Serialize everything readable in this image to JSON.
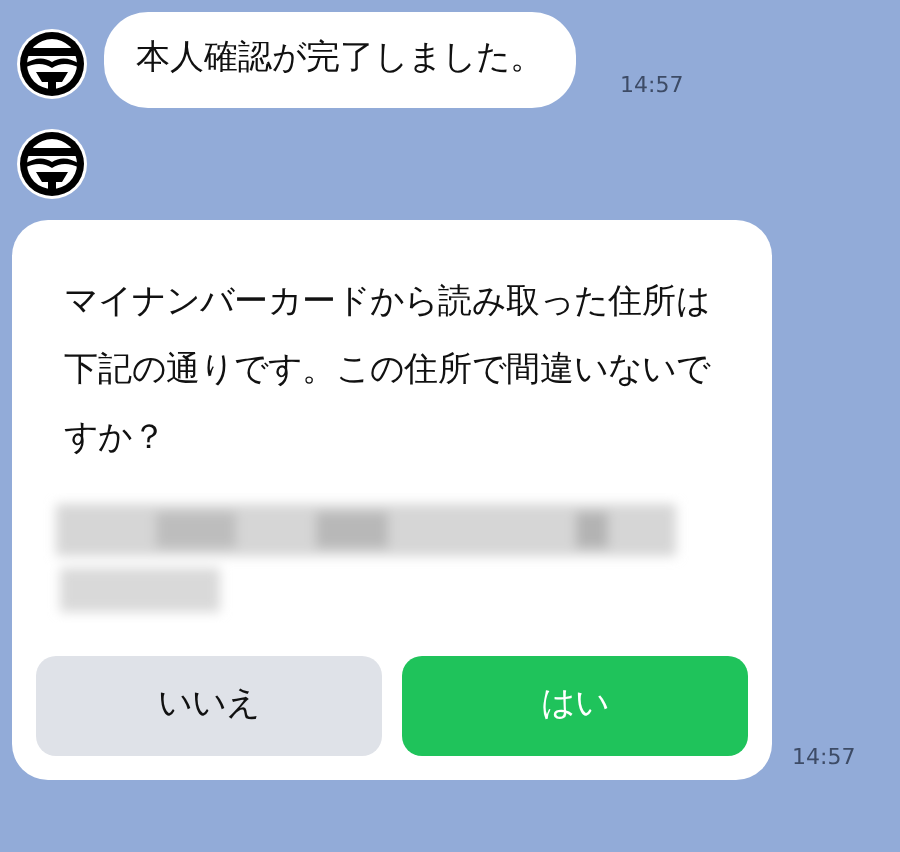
{
  "messages": [
    {
      "kind": "text",
      "text": "本人確認が完了しました。",
      "time": "14:57"
    },
    {
      "kind": "confirm",
      "text": "マイナンバーカードから読み取った住所は下記の通りです。この住所で間違いないですか？",
      "time": "14:57",
      "buttons": [
        {
          "label": "いいえ",
          "kind": "secondary"
        },
        {
          "label": "はい",
          "kind": "primary"
        }
      ]
    }
  ]
}
